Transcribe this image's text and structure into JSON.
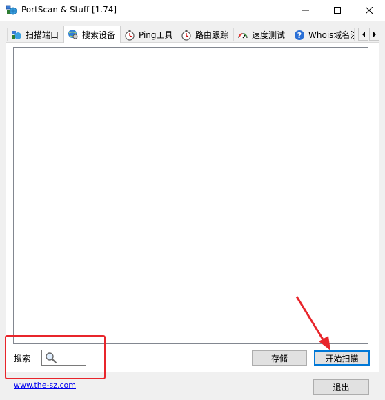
{
  "window": {
    "title": "PortScan & Stuff [1.74]"
  },
  "tabs": [
    {
      "label": "扫描端口",
      "icon": "network-globe-icon",
      "active": false
    },
    {
      "label": "搜索设备",
      "icon": "globe-search-icon",
      "active": true
    },
    {
      "label": "Ping工具",
      "icon": "stopwatch-icon",
      "active": false
    },
    {
      "label": "路由跟踪",
      "icon": "stopwatch-icon",
      "active": false
    },
    {
      "label": "速度测试",
      "icon": "speedometer-icon",
      "active": false
    },
    {
      "label": "Whois域名注",
      "icon": "help-circle-icon",
      "active": false
    }
  ],
  "search": {
    "label": "搜索",
    "value": ""
  },
  "buttons": {
    "save": "存储",
    "start_scan": "开始扫描",
    "exit": "退出"
  },
  "footer": {
    "link": "www.the-sz.com"
  },
  "colors": {
    "annotation": "#e8252b",
    "focus": "#0078d7",
    "link": "#0000ee"
  }
}
